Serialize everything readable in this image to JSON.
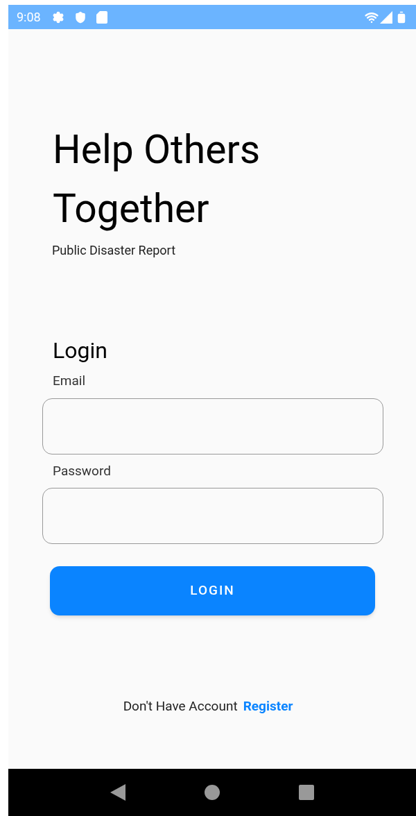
{
  "status_bar": {
    "time": "9:08"
  },
  "header": {
    "title": "Help Others Together",
    "subtitle": "Public Disaster Report"
  },
  "form": {
    "heading": "Login",
    "fields": [
      {
        "label": "Email"
      },
      {
        "label": "Password"
      }
    ],
    "submit": "LOGIN"
  },
  "footer": {
    "prompt": "Don't Have Account",
    "link": "Register"
  }
}
